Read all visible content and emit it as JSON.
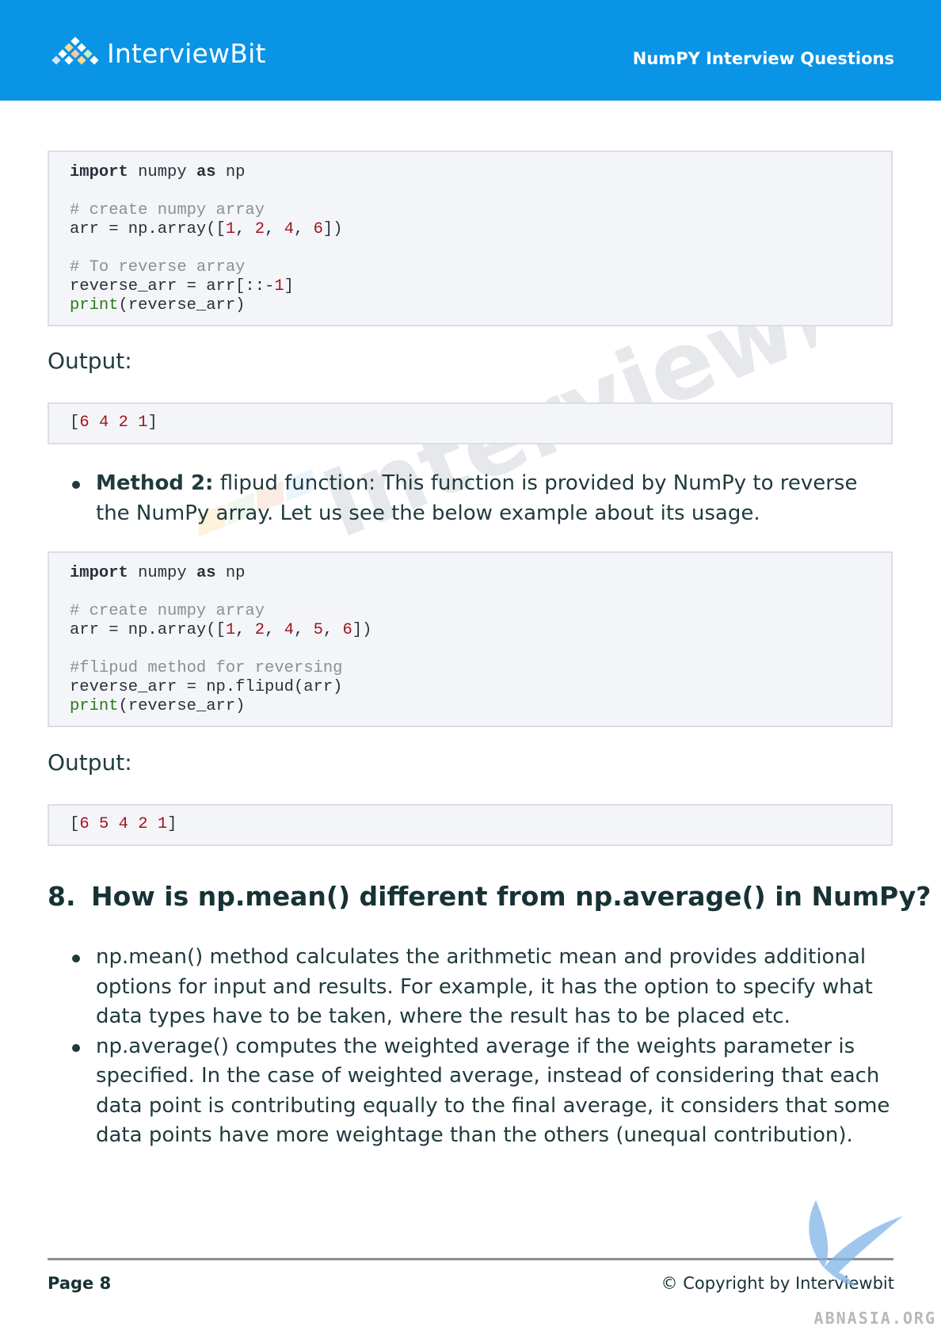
{
  "header": {
    "logo_text": "InterviewBit",
    "title": "NumPY Interview Questions",
    "background": "#0a94e6"
  },
  "watermark_text": "InterviewBit",
  "code_block_1": {
    "lines": [
      "import numpy as np",
      "",
      "# create numpy array",
      "arr = np.array([1, 2, 4, 6])",
      "",
      "# To reverse array",
      "reverse_arr = arr[::-1]",
      "print(reverse_arr)"
    ]
  },
  "output_1": {
    "label": "Output:",
    "value": "[6 4 2 1]"
  },
  "method2": {
    "bold": "Method 2:",
    "text": " flipud function: This function is provided by NumPy to reverse the NumPy array. Let us see the below example about its usage."
  },
  "code_block_2": {
    "lines": [
      "import numpy as np",
      "",
      "# create numpy array",
      "arr = np.array([1, 2, 4, 5, 6])",
      "",
      "#flipud method for reversing",
      "reverse_arr = np.flipud(arr)",
      "print(reverse_arr)"
    ]
  },
  "output_2": {
    "label": "Output:",
    "value": "[6 5 4 2 1]"
  },
  "section8": {
    "number": "8.",
    "title": "How is np.mean() different from np.average() in NumPy?",
    "bullets": [
      "np.mean() method calculates the arithmetic mean and provides additional options for input and results. For example, it has the option to specify what data types have to be taken, where the result has to be placed etc.",
      "np.average() computes the weighted average if the weights parameter is specified. In the case of weighted average, instead of considering that each data point is contributing equally to the final average, it considers that some data points have more weightage than the others (unequal contribution)."
    ]
  },
  "footer": {
    "page": "Page 8",
    "copyright": "© Copyright by Interviewbit",
    "site_mark": "ABNASIA.ORG"
  }
}
